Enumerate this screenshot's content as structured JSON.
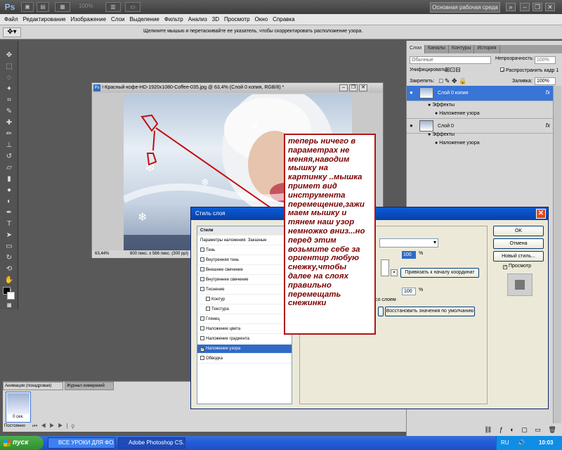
{
  "titlebar": {
    "logo": "Ps",
    "zoom": "100%",
    "workspace": "Основная рабочая среда",
    "tb_icons": [
      "br-icon",
      "mb-icon",
      "zoom-arrange-icon",
      "screen-mode-icon"
    ]
  },
  "menu": [
    "Файл",
    "Редактирование",
    "Изображение",
    "Слои",
    "Выделение",
    "Фильтр",
    "Анализ",
    "3D",
    "Просмотр",
    "Окно",
    "Справка"
  ],
  "options_hint": "Щелкните мышью и перетаскивайте ее указатель, чтобы скорректировать расположение узора.",
  "document": {
    "title": "!-Красный-кофе-HD-1920x1080-Coffee-035.jpg @ 63,4% (Слой 0 копия, RGB/8) *",
    "zoom": "63,44%",
    "info": "800 пикс. x 566 пикс. (300 ppi)"
  },
  "layers_panel": {
    "tabs": [
      "Слои",
      "Каналы",
      "Контуры",
      "История"
    ],
    "blend_mode": "Обычные",
    "opacity_label": "Непрозрачность:",
    "opacity": "100%",
    "unify_label": "Унифицировать:",
    "propagate_label": "Распространить кадр 1",
    "lock_label": "Закрепить:",
    "fill_label": "Заливка:",
    "fill": "100%",
    "layers": [
      {
        "name": "Слой 0 копия",
        "effects_label": "Эффекты",
        "effect": "Наложение узора",
        "fx": "fx"
      },
      {
        "name": "Слой 0",
        "effects_label": "Эффекты",
        "effect": "Наложение узора",
        "fx": "fx"
      }
    ]
  },
  "animation_panel": {
    "tabs": [
      "Анимация (покадровая)",
      "Журнал измерений"
    ],
    "frame_time": "0 сек.",
    "loop": "Постоянно"
  },
  "dialog": {
    "title": "Стиль слоя",
    "styles_header": "Стили",
    "blend_options": "Параметры наложения: Заказные",
    "items": [
      {
        "label": "Тень",
        "checked": false,
        "indent": false,
        "selected": false
      },
      {
        "label": "Внутренняя тень",
        "checked": false,
        "indent": false,
        "selected": false
      },
      {
        "label": "Внешнее свечение",
        "checked": false,
        "indent": false,
        "selected": false
      },
      {
        "label": "Внутреннее свечение",
        "checked": false,
        "indent": false,
        "selected": false
      },
      {
        "label": "Тиснение",
        "checked": false,
        "indent": false,
        "selected": false
      },
      {
        "label": "Контур",
        "checked": false,
        "indent": true,
        "selected": false
      },
      {
        "label": "Текстура",
        "checked": false,
        "indent": true,
        "selected": false
      },
      {
        "label": "Глянец",
        "checked": false,
        "indent": false,
        "selected": false
      },
      {
        "label": "Наложение цвета",
        "checked": false,
        "indent": false,
        "selected": false
      },
      {
        "label": "Наложение градиента",
        "checked": false,
        "indent": false,
        "selected": false
      },
      {
        "label": "Наложение узора",
        "checked": true,
        "indent": false,
        "selected": true
      },
      {
        "label": "Обводка",
        "checked": false,
        "indent": false,
        "selected": false
      }
    ],
    "opacity_value": "100",
    "percent": "%",
    "scale_value": "100",
    "snap_button": "Привязать к началу координат",
    "link_label": "со слоем",
    "reset_button": "Восстановить значения по умолчанию",
    "ok": "OK",
    "cancel": "Отмена",
    "new_style": "Новый стиль...",
    "preview": "Просмотр"
  },
  "annotation": "теперь ничего в\nпараметрах не\nменяя,наводим\nмышку на\nкартинку ..мышка\nпримет вид\nинструмента\nперемещение,зажи\nмаем мышку и\nтянем наш узор\nнемножко вниз...но\nперед этим\nвозьмите себе за\nориентир любую\nснежку,чтобы\nдалее на слоях\nправильно\nперемещать\nснежинки",
  "taskbar": {
    "start": "пуск",
    "tasks": [
      "ВСЕ УРОКИ ДЛЯ ФО...",
      "Adobe Photoshop CS..."
    ],
    "lang": "RU",
    "time": "10:03"
  }
}
